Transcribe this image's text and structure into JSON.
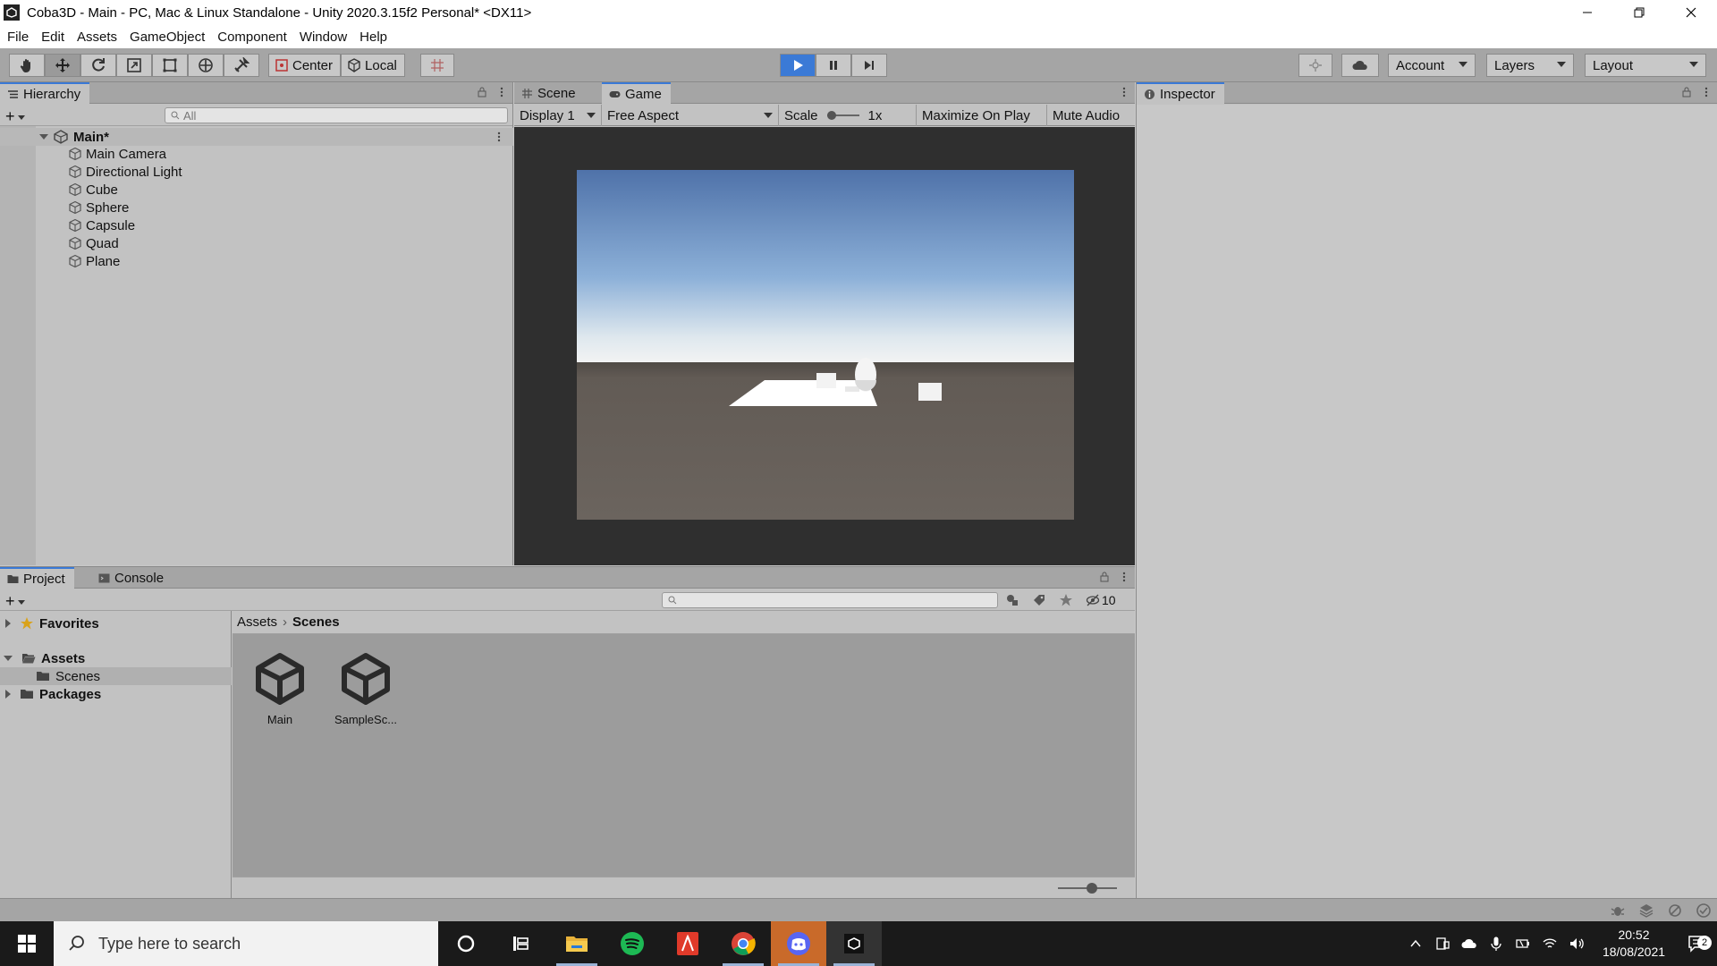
{
  "window": {
    "title": "Coba3D - Main - PC, Mac & Linux Standalone - Unity 2020.3.15f2 Personal* <DX11>"
  },
  "menu": [
    "File",
    "Edit",
    "Assets",
    "GameObject",
    "Component",
    "Window",
    "Help"
  ],
  "toolbar": {
    "pivot_center": "Center",
    "pivot_local": "Local",
    "account": "Account",
    "layers": "Layers",
    "layout": "Layout",
    "play_state": "playing"
  },
  "hierarchy": {
    "tab": "Hierarchy",
    "search_placeholder": "All",
    "scene": "Main*",
    "items": [
      "Main Camera",
      "Directional Light",
      "Cube",
      "Sphere",
      "Capsule",
      "Quad",
      "Plane"
    ]
  },
  "scene_tab": "Scene",
  "game": {
    "tab": "Game",
    "display": "Display 1",
    "aspect": "Free Aspect",
    "scale_label": "Scale",
    "scale_value": "1x",
    "maximize": "Maximize On Play",
    "mute": "Mute Audio"
  },
  "inspector": {
    "tab": "Inspector"
  },
  "project": {
    "tab": "Project",
    "console_tab": "Console",
    "hidden_count": "10",
    "tree": {
      "favorites": "Favorites",
      "assets": "Assets",
      "scenes": "Scenes",
      "packages": "Packages"
    },
    "breadcrumb": [
      "Assets",
      "Scenes"
    ],
    "assets": [
      "Main",
      "SampleSc..."
    ]
  },
  "taskbar": {
    "search_placeholder": "Type here to search",
    "time": "20:52",
    "date": "18/08/2021",
    "notifications": "2"
  },
  "colors": {
    "accent": "#3a79d6",
    "play_active": "#3b7ad6",
    "sky_top": "#4f72a9",
    "ground": "#6b6560"
  }
}
